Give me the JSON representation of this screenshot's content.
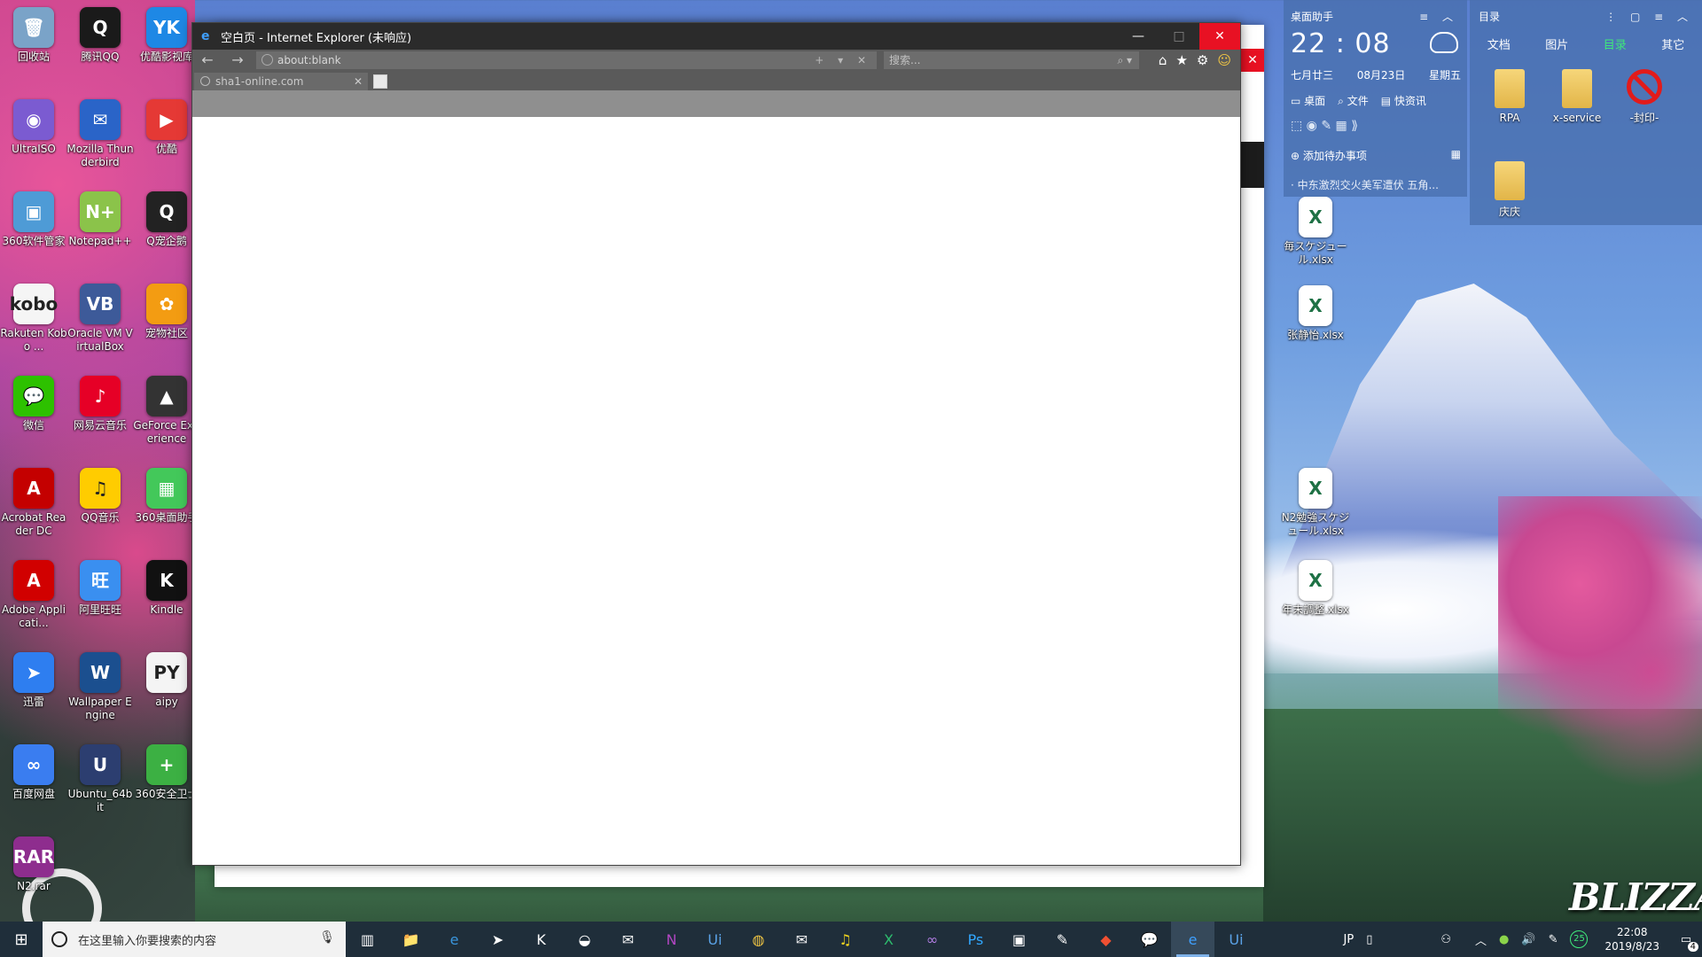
{
  "desktop_icons": [
    {
      "label": "回收站",
      "color": "#7aa3c8",
      "glyph": "🗑"
    },
    {
      "label": "腾讯QQ",
      "color": "#1a1a1a",
      "glyph": "Q"
    },
    {
      "label": "优酷影视库",
      "color": "#1e88e5",
      "glyph": "YK"
    },
    {
      "label": "UltraISO",
      "color": "#7b5bd1",
      "glyph": "◉"
    },
    {
      "label": "Mozilla Thunderbird",
      "color": "#2a64c8",
      "glyph": "✉"
    },
    {
      "label": "优酷",
      "color": "#e53935",
      "glyph": "▶"
    },
    {
      "label": "360软件管家",
      "color": "#4e9bd6",
      "glyph": "▣"
    },
    {
      "label": "Notepad++",
      "color": "#8bc34a",
      "glyph": "N+"
    },
    {
      "label": "Q宠企鹅",
      "color": "#222222",
      "glyph": "Q"
    },
    {
      "label": "Rakuten Kobo ...",
      "color": "#f5f5f5",
      "glyph": "kobo"
    },
    {
      "label": "Oracle VM VirtualBox",
      "color": "#3d5a99",
      "glyph": "VB"
    },
    {
      "label": "宠物社区",
      "color": "#f39c12",
      "glyph": "✿"
    },
    {
      "label": "微信",
      "color": "#2dc100",
      "glyph": "💬"
    },
    {
      "label": "网易云音乐",
      "color": "#e60026",
      "glyph": "♪"
    },
    {
      "label": "GeForce Experience",
      "color": "#333333",
      "glyph": "▲"
    },
    {
      "label": "Acrobat Reader DC",
      "color": "#c40000",
      "glyph": "A"
    },
    {
      "label": "QQ音乐",
      "color": "#ffcc00",
      "glyph": "♫"
    },
    {
      "label": "360桌面助手",
      "color": "#43c85a",
      "glyph": "▦"
    },
    {
      "label": "Adobe Applicati...",
      "color": "#d10000",
      "glyph": "A"
    },
    {
      "label": "阿里旺旺",
      "color": "#3a8ff0",
      "glyph": "旺"
    },
    {
      "label": "Kindle",
      "color": "#111111",
      "glyph": "K"
    },
    {
      "label": "迅雷",
      "color": "#2e7ef0",
      "glyph": "➤"
    },
    {
      "label": "Wallpaper Engine",
      "color": "#1b4f8f",
      "glyph": "W"
    },
    {
      "label": "aipy",
      "color": "#f4f4f4",
      "glyph": "PY"
    },
    {
      "label": "百度网盘",
      "color": "#3a7df0",
      "glyph": "∞"
    },
    {
      "label": "Ubuntu_64bit",
      "color": "#2c3e70",
      "glyph": "U"
    },
    {
      "label": "360安全卫士",
      "color": "#3cb043",
      "glyph": "+"
    },
    {
      "label": "N2.rar",
      "color": "#8e2d8e",
      "glyph": "RAR"
    }
  ],
  "ie": {
    "title": "空白页 - Internet Explorer (未响应)",
    "address": "about:blank",
    "search_placeholder": "搜索...",
    "tab_label": "sha1-online.com",
    "minimize": "—",
    "maximize": "□",
    "close": "✕",
    "back": "←",
    "forward": "→",
    "addr_tools": "+ ▾ ✕",
    "search_icon": "⌕ ▾",
    "home": "⌂",
    "favorites": "★",
    "settings": "⚙",
    "smile": "☺",
    "tab_close": "✕"
  },
  "assistant": {
    "title": "桌面助手",
    "time": "22 : 08",
    "lunar": "七月廿三",
    "date": "08月23日",
    "weekday": "星期五",
    "quick": [
      "桌面",
      "文件",
      "快资讯"
    ],
    "todo": "添加待办事项",
    "news": "中东激烈交火美军遭伏 五角...",
    "tools_icons": "⬚ ◉ ✎ ▦ ⟫",
    "hdr_tools": "≡ ︿"
  },
  "catalog": {
    "title": "目录",
    "tabs": [
      "文档",
      "图片",
      "目录",
      "其它"
    ],
    "active_tab": "目录",
    "items": [
      "RPA",
      "x-service",
      "-封印-",
      "庆庆"
    ],
    "hdr_tools": "⋮ ▢ ≡ ︿"
  },
  "right_files": [
    {
      "label": "毎スケジュール.xlsx"
    },
    {
      "label": "张静怡.xlsx"
    },
    {
      "label": "N2勉強スケジュール.xlsx"
    },
    {
      "label": "年末調整.xlsx"
    }
  ],
  "taskbar": {
    "search_placeholder": "在这里输入你要搜索的内容",
    "clock_time": "22:08",
    "clock_date": "2019/8/23",
    "ime": "JP",
    "notification_count": "4",
    "tray_badge": "25",
    "apps": [
      "task-view",
      "file-explorer",
      "edge",
      "xunlei",
      "kindle",
      "android",
      "thunderbird",
      "onenote",
      "uipath",
      "chrome",
      "mail",
      "qqmusic",
      "excel",
      "visual-studio",
      "photoshop",
      "remote",
      "paint",
      "git",
      "wechat",
      "ie",
      "uipath-studio"
    ]
  },
  "wallpaper": {
    "brand": "BLIZZARD"
  }
}
